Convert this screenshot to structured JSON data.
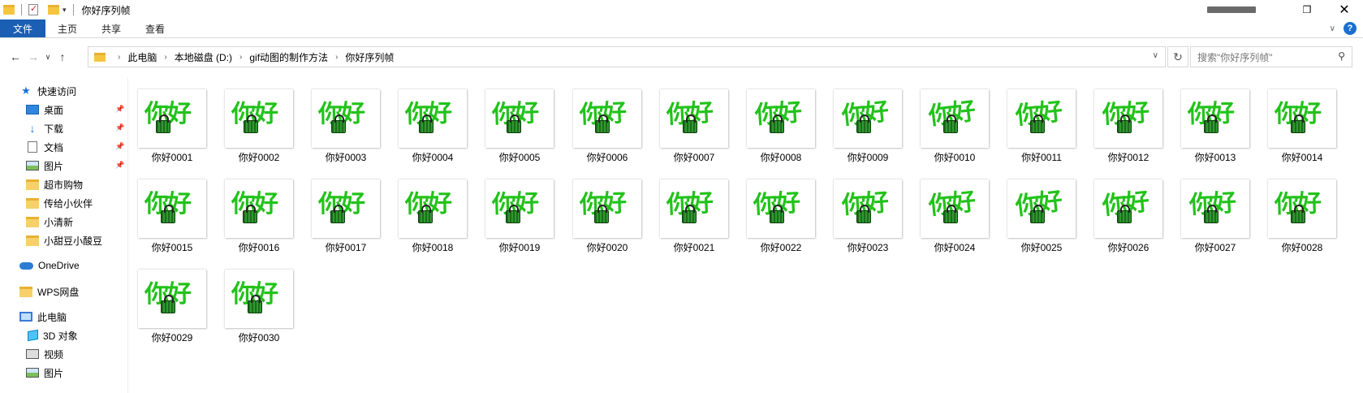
{
  "window": {
    "title": "你好序列帧"
  },
  "ribbon": {
    "tabs": [
      "文件",
      "主页",
      "共享",
      "查看"
    ]
  },
  "nav": {
    "breadcrumb": [
      "此电脑",
      "本地磁盘 (D:)",
      "gif动图的制作方法",
      "你好序列帧"
    ],
    "search_placeholder": "搜索\"你好序列帧\""
  },
  "sidebar": {
    "items": [
      {
        "label": "快速访问",
        "icon": "star-icon"
      },
      {
        "label": "桌面",
        "icon": "desktop-icon",
        "pinned": true
      },
      {
        "label": "下载",
        "icon": "download-icon",
        "pinned": true
      },
      {
        "label": "文档",
        "icon": "document-icon",
        "pinned": true
      },
      {
        "label": "图片",
        "icon": "pictures-icon",
        "pinned": true
      },
      {
        "label": "超市购物",
        "icon": "folder-icon"
      },
      {
        "label": "传给小伙伴",
        "icon": "folder-icon"
      },
      {
        "label": "小清新",
        "icon": "folder-icon"
      },
      {
        "label": "小甜豆小酸豆",
        "icon": "folder-icon"
      },
      {
        "label": "OneDrive",
        "icon": "cloud-icon"
      },
      {
        "label": "WPS网盘",
        "icon": "folder-icon"
      },
      {
        "label": "此电脑",
        "icon": "computer-icon"
      },
      {
        "label": "3D 对象",
        "icon": "cube-icon"
      },
      {
        "label": "视频",
        "icon": "video-icon"
      },
      {
        "label": "图片",
        "icon": "pictures-icon"
      }
    ]
  },
  "files": {
    "thumbnail_text": "你好",
    "names": [
      "你好0001",
      "你好0002",
      "你好0003",
      "你好0004",
      "你好0005",
      "你好0006",
      "你好0007",
      "你好0008",
      "你好0009",
      "你好0010",
      "你好0011",
      "你好0012",
      "你好0013",
      "你好0014",
      "你好0015",
      "你好0016",
      "你好0017",
      "你好0018",
      "你好0019",
      "你好0020",
      "你好0021",
      "你好0022",
      "你好0023",
      "你好0024",
      "你好0025",
      "你好0026",
      "你好0027",
      "你好0028",
      "你好0029",
      "你好0030"
    ]
  },
  "colors": {
    "file_tab_bg": "#1a5fb4",
    "thumbnail_text": "#22c21a"
  }
}
